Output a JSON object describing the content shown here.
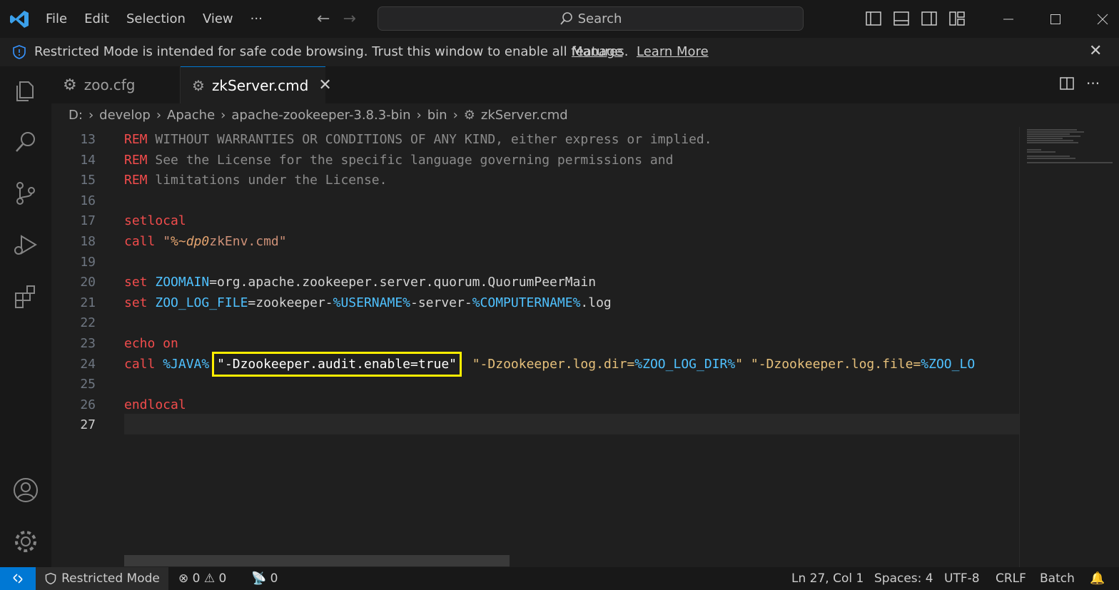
{
  "menu": [
    "File",
    "Edit",
    "Selection",
    "View",
    "···"
  ],
  "search": {
    "label": "Search"
  },
  "banner": {
    "message": "Restricted Mode is intended for safe code browsing. Trust this window to enable all features.",
    "manage": "Manage",
    "learn_more": "Learn More",
    "close": "✕"
  },
  "tabs": [
    {
      "label": "zoo.cfg",
      "icon": "gear-icon"
    },
    {
      "label": "zkServer.cmd",
      "icon": "gears-icon",
      "close": "✕"
    }
  ],
  "breadcrumb": [
    "D:",
    "develop",
    "Apache",
    "apache-zookeeper-3.8.3-bin",
    "bin",
    "zkServer.cmd"
  ],
  "editor": {
    "lines": [
      {
        "n": "13",
        "tokens": [
          [
            "kw",
            "REM"
          ],
          [
            "gray",
            " WITHOUT WARRANTIES OR CONDITIONS OF ANY KIND, either express or implied."
          ]
        ]
      },
      {
        "n": "14",
        "tokens": [
          [
            "kw",
            "REM"
          ],
          [
            "gray",
            " See the License for the specific language governing permissions and"
          ]
        ]
      },
      {
        "n": "15",
        "tokens": [
          [
            "kw",
            "REM"
          ],
          [
            "gray",
            " limitations under the License."
          ]
        ]
      },
      {
        "n": "16",
        "tokens": []
      },
      {
        "n": "17",
        "tokens": [
          [
            "kw",
            "setlocal"
          ]
        ]
      },
      {
        "n": "18",
        "tokens": [
          [
            "kw",
            "call"
          ],
          [
            "plain",
            " "
          ],
          [
            "str",
            "\""
          ],
          [
            "orange",
            "%~dp0"
          ],
          [
            "str",
            "zkEnv.cmd\""
          ]
        ]
      },
      {
        "n": "19",
        "tokens": []
      },
      {
        "n": "20",
        "tokens": [
          [
            "kw",
            "set"
          ],
          [
            "plain",
            " "
          ],
          [
            "var",
            "ZOOMAIN"
          ],
          [
            "plain",
            "=org.apache.zookeeper.server.quorum.QuorumPeerMain"
          ]
        ]
      },
      {
        "n": "21",
        "tokens": [
          [
            "kw",
            "set"
          ],
          [
            "plain",
            " "
          ],
          [
            "var",
            "ZOO_LOG_FILE"
          ],
          [
            "plain",
            "=zookeeper-"
          ],
          [
            "var",
            "%USERNAME%"
          ],
          [
            "plain",
            "-server-"
          ],
          [
            "var",
            "%COMPUTERNAME%"
          ],
          [
            "plain",
            ".log"
          ]
        ]
      },
      {
        "n": "22",
        "tokens": []
      },
      {
        "n": "23",
        "tokens": [
          [
            "kw",
            "echo on"
          ]
        ]
      },
      {
        "n": "24",
        "tokens": [
          [
            "kw",
            "call"
          ],
          [
            "plain",
            " "
          ],
          [
            "var",
            "%JAVA%"
          ],
          [
            "plain",
            " "
          ],
          [
            "hl",
            "\"-Dzookeeper.audit.enable=true\""
          ],
          [
            "plain",
            "  "
          ],
          [
            "yellow",
            "\"-Dzookeeper.log.dir="
          ],
          [
            "var",
            "%ZOO_LOG_DIR%"
          ],
          [
            "yellow",
            "\""
          ],
          [
            "plain",
            " "
          ],
          [
            "yellow",
            "\"-Dzookeeper.log.file="
          ],
          [
            "var",
            "%ZOO_LO"
          ]
        ]
      },
      {
        "n": "25",
        "tokens": []
      },
      {
        "n": "26",
        "tokens": [
          [
            "kw",
            "endlocal"
          ]
        ]
      },
      {
        "n": "27",
        "tokens": [],
        "current": true
      }
    ]
  },
  "status": {
    "remote_icon": "remote-icon",
    "restricted": "Restricted Mode",
    "errors": "0",
    "warnings": "0",
    "ports": "0",
    "position": "Ln 27, Col 1",
    "spaces": "Spaces: 4",
    "encoding": "UTF-8",
    "eol": "CRLF",
    "language": "Batch"
  },
  "colors": {
    "accent": "#0078d4",
    "highlight_box": "#ffee00"
  }
}
